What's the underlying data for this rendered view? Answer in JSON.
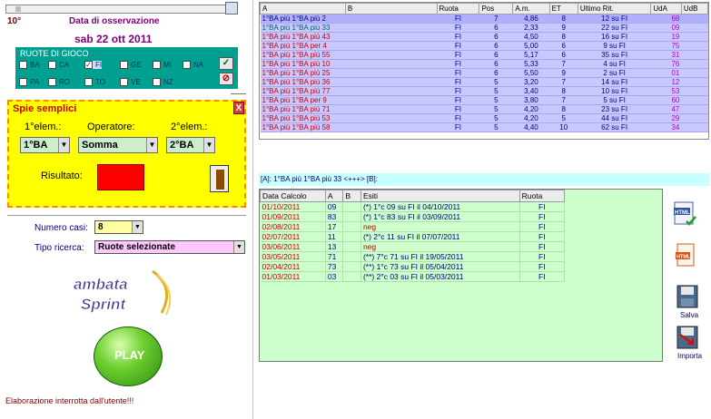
{
  "left": {
    "counter": "10°",
    "obs_label": "Data di osservazione",
    "obs_date": "sab 22 ott 2011",
    "ruote_title": "RUOTE DI GIOCO",
    "ruote": [
      {
        "label": "BA",
        "checked": false
      },
      {
        "label": "CA",
        "checked": false
      },
      {
        "label": "FI",
        "checked": true
      },
      {
        "label": "GE",
        "checked": false
      },
      {
        "label": "MI",
        "checked": false
      },
      {
        "label": "NA",
        "checked": false
      },
      {
        "label": "PA",
        "checked": false
      },
      {
        "label": "RO",
        "checked": false
      },
      {
        "label": "TO",
        "checked": false
      },
      {
        "label": "VE",
        "checked": false
      },
      {
        "label": "NZ",
        "checked": false
      }
    ],
    "spie_title": "Spie semplici",
    "close_label": "X",
    "elem1_label": "1°elem.:",
    "operatore_label": "Operatore:",
    "elem2_label": "2°elem.:",
    "elem1_value": "1°BA",
    "operatore_value": "Somma",
    "elem2_value": "2°BA",
    "risultato_label": "Risultato:",
    "numero_casi_label": "Numero casi:",
    "numero_casi_value": "8",
    "tipo_ricerca_label": "Tipo ricerca:",
    "tipo_ricerca_value": "Ruote selezionate",
    "logo_line1": "ambata",
    "logo_line2": "Sprint",
    "play_label": "PLAY",
    "status": "Elaborazione interrotta dall'utente!!!"
  },
  "grid": {
    "headers": [
      "A",
      "B",
      "Ruota",
      "Pos",
      "A.m.",
      "ET",
      "Ultimo Rit.",
      "UdA",
      "UdB"
    ],
    "rows": [
      {
        "a": "1°BA più  1°BA  più 2",
        "b": "",
        "ruota": "FI",
        "pos": "7",
        "am": "4,86",
        "et": "8",
        "rit": "12 su FI",
        "uda": "68",
        "udb": "",
        "ca": "#000080"
      },
      {
        "a": "1°BA più  1°BA  più 33",
        "b": "",
        "ruota": "FI",
        "pos": "6",
        "am": "2,33",
        "et": "9",
        "rit": "22 su FI",
        "uda": "09",
        "udb": "",
        "ca": "#006666"
      },
      {
        "a": "1°BA più  1°BA  più 43",
        "b": "",
        "ruota": "FI",
        "pos": "6",
        "am": "4,50",
        "et": "8",
        "rit": "16 su FI",
        "uda": "19",
        "udb": "",
        "ca": "#cc0000"
      },
      {
        "a": "1°BA più  1°BA  per 4",
        "b": "",
        "ruota": "FI",
        "pos": "6",
        "am": "5,00",
        "et": "6",
        "rit": "9 su FI",
        "uda": "75",
        "udb": "",
        "ca": "#cc0000"
      },
      {
        "a": "1°BA più  1°BA  più 55",
        "b": "",
        "ruota": "FI",
        "pos": "6",
        "am": "5,17",
        "et": "6",
        "rit": "35 su FI",
        "uda": "31",
        "udb": "",
        "ca": "#cc0000"
      },
      {
        "a": "1°BA più  1°BA  più 10",
        "b": "",
        "ruota": "FI",
        "pos": "6",
        "am": "5,33",
        "et": "7",
        "rit": "4 su FI",
        "uda": "76",
        "udb": "",
        "ca": "#cc0000"
      },
      {
        "a": "1°BA più  1°BA  più 25",
        "b": "",
        "ruota": "FI",
        "pos": "6",
        "am": "5,50",
        "et": "9",
        "rit": "2 su FI",
        "uda": "01",
        "udb": "",
        "ca": "#cc0000"
      },
      {
        "a": "1°BA più  1°BA  più 36",
        "b": "",
        "ruota": "FI",
        "pos": "5",
        "am": "3,20",
        "et": "7",
        "rit": "14 su FI",
        "uda": "12",
        "udb": "",
        "ca": "#cc0000"
      },
      {
        "a": "1°BA più  1°BA  più 77",
        "b": "",
        "ruota": "FI",
        "pos": "5",
        "am": "3,40",
        "et": "8",
        "rit": "10 su FI",
        "uda": "53",
        "udb": "",
        "ca": "#cc0000"
      },
      {
        "a": "1°BA più  1°BA  per 9",
        "b": "",
        "ruota": "FI",
        "pos": "5",
        "am": "3,80",
        "et": "7",
        "rit": "5 su FI",
        "uda": "60",
        "udb": "",
        "ca": "#cc0000"
      },
      {
        "a": "1°BA più  1°BA  più 71",
        "b": "",
        "ruota": "FI",
        "pos": "5",
        "am": "4,20",
        "et": "8",
        "rit": "23 su FI",
        "uda": "47",
        "udb": "",
        "ca": "#cc0000"
      },
      {
        "a": "1°BA più  1°BA  più 53",
        "b": "",
        "ruota": "FI",
        "pos": "5",
        "am": "4,20",
        "et": "5",
        "rit": "44 su FI",
        "uda": "29",
        "udb": "",
        "ca": "#cc0000"
      },
      {
        "a": "1°BA più  1°BA  più 58",
        "b": "",
        "ruota": "FI",
        "pos": "5",
        "am": "4,40",
        "et": "10",
        "rit": "62 su FI",
        "uda": "34",
        "udb": "",
        "ca": "#cc0000"
      }
    ]
  },
  "formula": "[A]: 1°BA più  1°BA  più 33 <+++> [B]:",
  "grid2": {
    "headers": [
      "Data Calcolo",
      "A",
      "B",
      "Esiti",
      "Ruota"
    ],
    "rows": [
      {
        "date": "01/10/2011",
        "a": "09",
        "b": "",
        "esito": "(*) 1°c 09 su FI il 04/10/2011",
        "ruota": "FI",
        "neg": false
      },
      {
        "date": "01/09/2011",
        "a": "83",
        "b": "",
        "esito": "(*) 1°c 83 su FI il 03/09/2011",
        "ruota": "FI",
        "neg": false
      },
      {
        "date": "02/08/2011",
        "a": "17",
        "b": "",
        "esito": "neg",
        "ruota": "FI",
        "neg": true
      },
      {
        "date": "02/07/2011",
        "a": "11",
        "b": "",
        "esito": "(*) 2°c 11 su FI il 07/07/2011",
        "ruota": "FI",
        "neg": false
      },
      {
        "date": "03/06/2011",
        "a": "13",
        "b": "",
        "esito": "neg",
        "ruota": "FI",
        "neg": true
      },
      {
        "date": "03/05/2011",
        "a": "71",
        "b": "",
        "esito": "(**) 7°c 71 su FI il 19/05/2011",
        "ruota": "FI",
        "neg": false
      },
      {
        "date": "02/04/2011",
        "a": "73",
        "b": "",
        "esito": "(**) 1°c 73 su FI il 05/04/2011",
        "ruota": "FI",
        "neg": false
      },
      {
        "date": "01/03/2011",
        "a": "03",
        "b": "",
        "esito": "(**) 2°c 03 su FI il 05/03/2011",
        "ruota": "FI",
        "neg": false
      }
    ]
  },
  "side": {
    "html1": "HTML",
    "html2": "HTML",
    "salva": "Salva",
    "importa": "Importa"
  }
}
